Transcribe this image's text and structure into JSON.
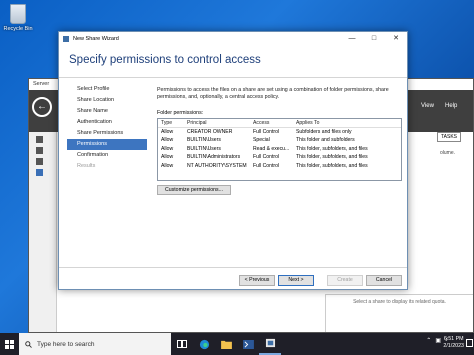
{
  "desktop": {
    "recycle_bin_label": "Recycle Bin"
  },
  "server_manager": {
    "title": "Server",
    "menu_view": "View",
    "menu_help": "Help",
    "tasks_label": "TASKS",
    "volume_text": "olume.",
    "bottom_panel_text": "Select a share to display its related quota."
  },
  "wizard": {
    "window_title": "New Share Wizard",
    "heading": "Specify permissions to control access",
    "steps": [
      {
        "label": "Select Profile",
        "state": "normal"
      },
      {
        "label": "Share Location",
        "state": "normal"
      },
      {
        "label": "Share Name",
        "state": "normal"
      },
      {
        "label": "Authentication",
        "state": "normal"
      },
      {
        "label": "Share Permissions",
        "state": "normal"
      },
      {
        "label": "Permissions",
        "state": "active"
      },
      {
        "label": "Confirmation",
        "state": "normal"
      },
      {
        "label": "Results",
        "state": "disabled"
      }
    ],
    "description": "Permissions to access the files on a share are set using a combination of folder permissions, share permissions, and, optionally, a central access policy.",
    "folder_permissions_label": "Folder permissions:",
    "columns": {
      "type": "Type",
      "principal": "Principal",
      "access": "Access",
      "applies": "Applies To"
    },
    "rows": [
      {
        "type": "Allow",
        "principal": "CREATOR OWNER",
        "access": "Full Control",
        "applies": "Subfolders and files only"
      },
      {
        "type": "Allow",
        "principal": "BUILTIN\\Users",
        "access": "Special",
        "applies": "This folder and subfolders"
      },
      {
        "type": "Allow",
        "principal": "BUILTIN\\Users",
        "access": "Read & execu...",
        "applies": "This folder, subfolders, and files"
      },
      {
        "type": "Allow",
        "principal": "BUILTIN\\Administrators",
        "access": "Full Control",
        "applies": "This folder, subfolders, and files"
      },
      {
        "type": "Allow",
        "principal": "NT AUTHORITY\\SYSTEM",
        "access": "Full Control",
        "applies": "This folder, subfolders, and files"
      }
    ],
    "customize_button": "Customize permissions...",
    "buttons": {
      "previous": "< Previous",
      "next": "Next >",
      "create": "Create",
      "cancel": "Cancel"
    }
  },
  "taskbar": {
    "search_placeholder": "Type here to search",
    "time": "6:51 PM",
    "date": "2/1/2023"
  }
}
